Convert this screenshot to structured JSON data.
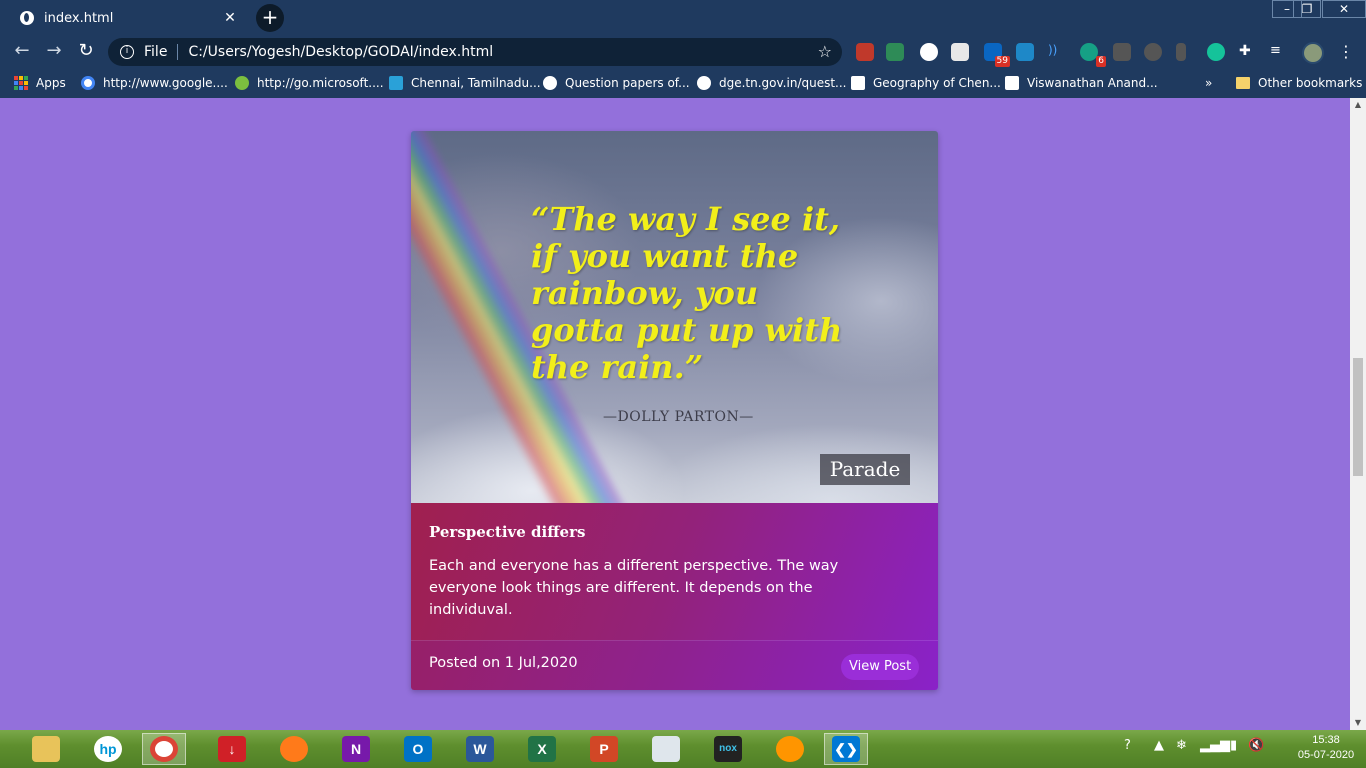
{
  "browser": {
    "tab_title": "index.html",
    "address_scheme": "File",
    "address_url": "C:/Users/Yogesh/Desktop/GODAI/index.html",
    "extension_badges": {
      "ext_linkedin": "59",
      "ext_grammarly_counter": "6"
    }
  },
  "bookmarks": [
    {
      "label": "Apps"
    },
    {
      "label": "http://www.google...."
    },
    {
      "label": "http://go.microsoft...."
    },
    {
      "label": "Chennai, Tamilnadu..."
    },
    {
      "label": "Question papers of..."
    },
    {
      "label": "dge.tn.gov.in/quest..."
    },
    {
      "label": "Geography of Chen..."
    },
    {
      "label": "Viswanathan Anand..."
    },
    {
      "label": "»"
    },
    {
      "label": "Other bookmarks"
    }
  ],
  "card": {
    "image": {
      "quote": "“The way I see it,\nif you want the\nrainbow, you\ngotta put up with\nthe rain.”",
      "author": "—DOLLY PARTON—",
      "watermark": "Parade"
    },
    "title": "Perspective differs",
    "text": "Each and everyone has a different perspective. The way everyone look things are different. It depends on the individuval.",
    "posted": "Posted on 1 Jul,2020",
    "view_button": "View Post"
  },
  "taskbar": {
    "apps": [
      "file-explorer",
      "hp",
      "chrome",
      "downloader",
      "firefox-dev",
      "onenote",
      "outlook",
      "word",
      "excel",
      "powerpoint",
      "resource-monitor",
      "nox",
      "firefox",
      "vscode"
    ],
    "clock_time": "15:38",
    "clock_date": "05-07-2020"
  },
  "colors": {
    "page_background": "#9370db",
    "chrome_frame": "#1f3a5f",
    "quote_text": "#f2ef1a",
    "card_body_start": "#a0204f",
    "card_body_end": "#8b22c0"
  }
}
